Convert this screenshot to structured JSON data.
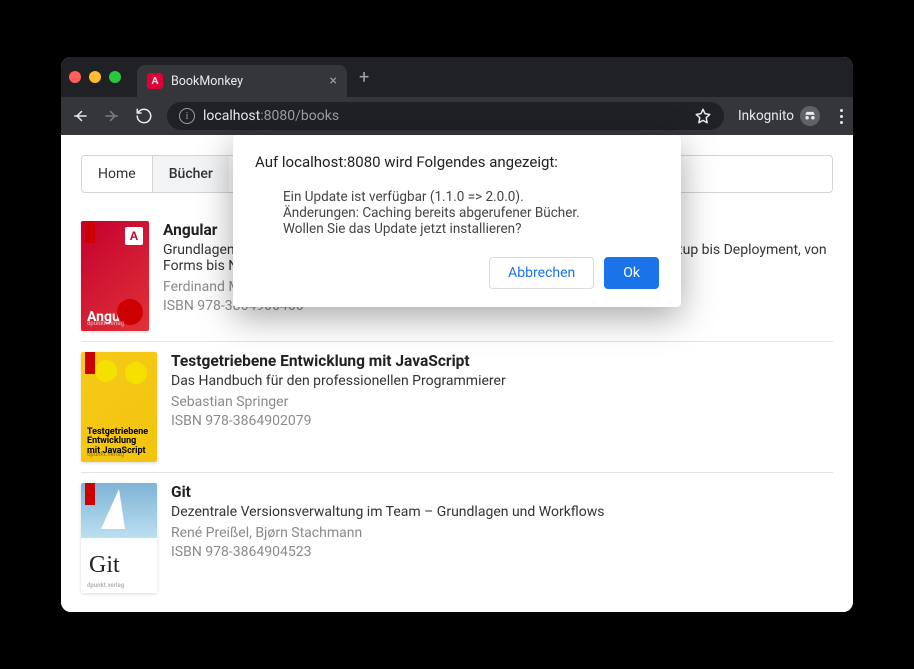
{
  "browser": {
    "tab_title": "BookMonkey",
    "favicon_letter": "A",
    "url_host": "localhost",
    "url_port": ":8080",
    "url_path": "/books",
    "incognito_label": "Inkognito"
  },
  "nav": {
    "items": [
      {
        "label": "Home",
        "active": false
      },
      {
        "label": "Bücher",
        "active": true
      }
    ]
  },
  "books": [
    {
      "thumb_class": "red",
      "thumb_label": "Angular",
      "title": "Angular",
      "subtitle": "Grundlagen, fortgeschrittene Techniken und Best Practices mit TypeScript – von Setup bis Deployment, von Forms bis NgRx",
      "authors": "Ferdinand Malcher, Danny Koppenhagen, Johannes Hoppe, Gregor Woiwode",
      "isbn": "ISBN 978-3864906466"
    },
    {
      "thumb_class": "yellow",
      "thumb_label": "Testgetriebene Entwicklung mit JavaScript",
      "title": "Testgetriebene Entwicklung mit JavaScript",
      "subtitle": "Das Handbuch für den professionellen Programmierer",
      "authors": "Sebastian Springer",
      "isbn": "ISBN 978-3864902079"
    },
    {
      "thumb_class": "white",
      "thumb_label": "Git",
      "title": "Git",
      "subtitle": "Dezentrale Versionsverwaltung im Team – Grundlagen und Workflows",
      "authors": "René Preißel, Bjørn Stachmann",
      "isbn": "ISBN 978-3864904523"
    }
  ],
  "dialog": {
    "title": "Auf localhost:8080 wird Folgendes angezeigt:",
    "body": "Ein Update ist verfügbar (1.1.0 => 2.0.0).\nÄnderungen: Caching bereits abgerufener Bücher.\nWollen Sie das Update jetzt installieren?",
    "cancel": "Abbrechen",
    "ok": "Ok"
  }
}
